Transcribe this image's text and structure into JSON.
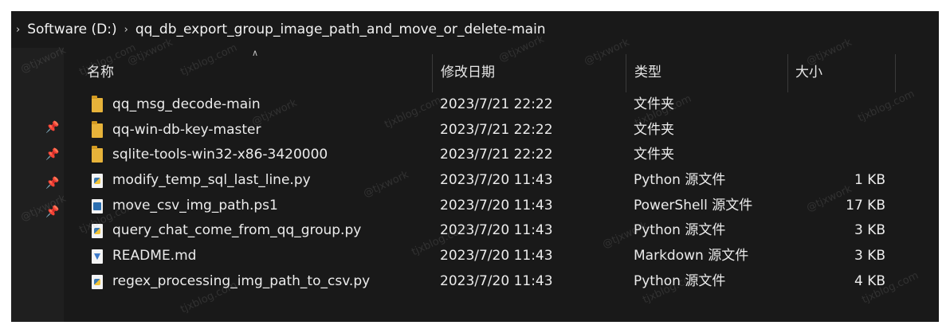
{
  "breadcrumb": {
    "segments": [
      "Software (D:)",
      "qq_db_export_group_image_path_and_move_or_delete-main"
    ]
  },
  "columns": {
    "name": "名称",
    "modified": "修改日期",
    "type": "类型",
    "size": "大小"
  },
  "files": [
    {
      "name": "qq_msg_decode-main",
      "modified": "2023/7/21 22:22",
      "type": "文件夹",
      "size": "",
      "icon": "folder-icon"
    },
    {
      "name": "qq-win-db-key-master",
      "modified": "2023/7/21 22:22",
      "type": "文件夹",
      "size": "",
      "icon": "folder-icon"
    },
    {
      "name": "sqlite-tools-win32-x86-3420000",
      "modified": "2023/7/21 22:22",
      "type": "文件夹",
      "size": "",
      "icon": "folder-icon"
    },
    {
      "name": "modify_temp_sql_last_line.py",
      "modified": "2023/7/20 11:43",
      "type": "Python 源文件",
      "size": "1 KB",
      "icon": "python-file-icon"
    },
    {
      "name": "move_csv_img_path.ps1",
      "modified": "2023/7/20 11:43",
      "type": "PowerShell 源文件",
      "size": "17 KB",
      "icon": "powershell-file-icon"
    },
    {
      "name": "query_chat_come_from_qq_group.py",
      "modified": "2023/7/20 11:43",
      "type": "Python 源文件",
      "size": "3 KB",
      "icon": "python-file-icon"
    },
    {
      "name": "README.md",
      "modified": "2023/7/20 11:43",
      "type": "Markdown 源文件",
      "size": "3 KB",
      "icon": "markdown-file-icon"
    },
    {
      "name": "regex_processing_img_path_to_csv.py",
      "modified": "2023/7/20 11:43",
      "type": "Python 源文件",
      "size": "4 KB",
      "icon": "python-file-icon"
    }
  ],
  "watermark": [
    "@tjxwork",
    "tjxblog.com"
  ]
}
